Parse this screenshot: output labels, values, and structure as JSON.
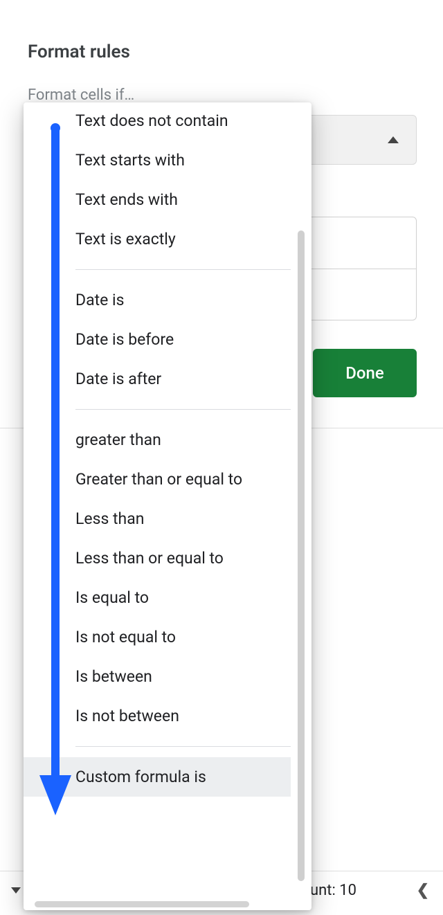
{
  "section": {
    "title": "Format rules",
    "subtitle": "Format cells if…"
  },
  "bg_select": {
    "collapsed_value": ""
  },
  "done_button": {
    "label": "Done"
  },
  "dropdown": {
    "groups": [
      {
        "items": [
          {
            "label": "Text does not contain"
          },
          {
            "label": "Text starts with"
          },
          {
            "label": "Text ends with"
          },
          {
            "label": "Text is exactly"
          }
        ]
      },
      {
        "items": [
          {
            "label": "Date is"
          },
          {
            "label": "Date is before"
          },
          {
            "label": "Date is after"
          }
        ]
      },
      {
        "items": [
          {
            "label": "greater than"
          },
          {
            "label": "Greater than or equal to"
          },
          {
            "label": "Less than"
          },
          {
            "label": "Less than or equal to"
          },
          {
            "label": "Is equal to"
          },
          {
            "label": "Is not equal to"
          },
          {
            "label": "Is between"
          },
          {
            "label": "Is not between"
          }
        ]
      },
      {
        "items": [
          {
            "label": "Custom formula is",
            "highlight": true
          }
        ]
      }
    ]
  },
  "bottom_bar": {
    "count_text": "unt: 10"
  }
}
